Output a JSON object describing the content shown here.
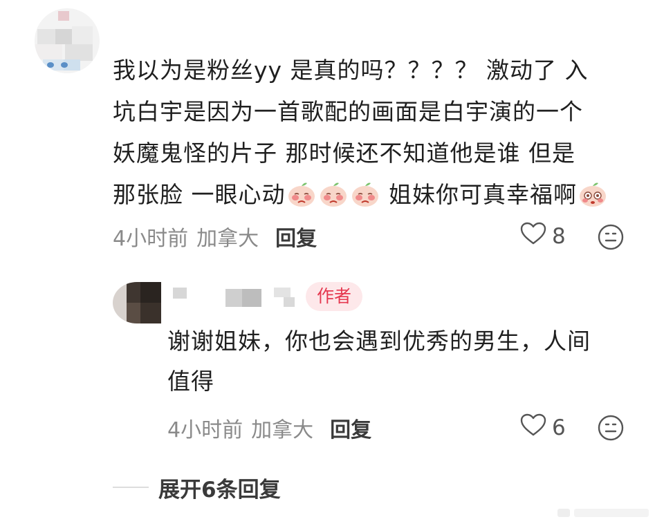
{
  "comment": {
    "avatar_icon": "blurred-avatar-icon",
    "text_lines": [
      "我以为是粉丝yy 是真的吗？？？？ 激动了 入",
      "坑白宇是因为一首歌配的画面是白宇演的一个",
      "妖魔鬼怪的片子 那时候还不知道他是谁 但是",
      "那张脸 一眼心动"
    ],
    "line4_suffix": "姐妹你可真幸福啊",
    "emoji_icon": "peach-blush-emoji-icon",
    "time": "4小时前",
    "location": "加拿大",
    "reply_label": "回复",
    "like_icon": "heart-outline-icon",
    "like_count": "8",
    "sticker_icon": "face-icon"
  },
  "reply": {
    "avatar_icon": "blurred-avatar-icon",
    "author_badge": "作者",
    "text_lines": [
      "谢谢姐妹，你也会遇到优秀的男生，人间",
      "值得"
    ],
    "time": "4小时前",
    "location": "加拿大",
    "reply_label": "回复",
    "like_icon": "heart-outline-icon",
    "like_count": "6",
    "sticker_icon": "face-icon"
  },
  "expand": {
    "label": "展开6条回复"
  },
  "colors": {
    "badge_bg": "#fde8ea",
    "badge_text": "#e5384f",
    "meta_text": "#8a8a8a",
    "body_text": "#1f1f1f"
  }
}
